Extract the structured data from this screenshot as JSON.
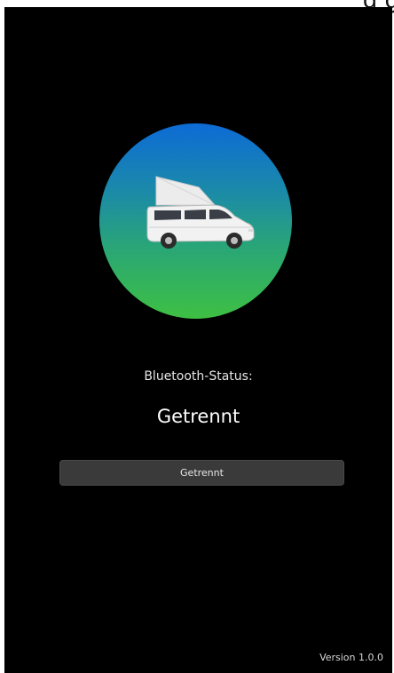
{
  "top_fragment": "g g",
  "app": {
    "logo_icon": "camper-van-icon",
    "colors": {
      "background": "#000000",
      "gradient_top": "#0d6bd6",
      "gradient_bottom": "#3ec043",
      "button": "#3a3a3a"
    }
  },
  "status": {
    "label": "Bluetooth-Status:",
    "value": "Getrennt"
  },
  "button": {
    "label": "Getrennt"
  },
  "footer": {
    "version": "Version 1.0.0"
  }
}
